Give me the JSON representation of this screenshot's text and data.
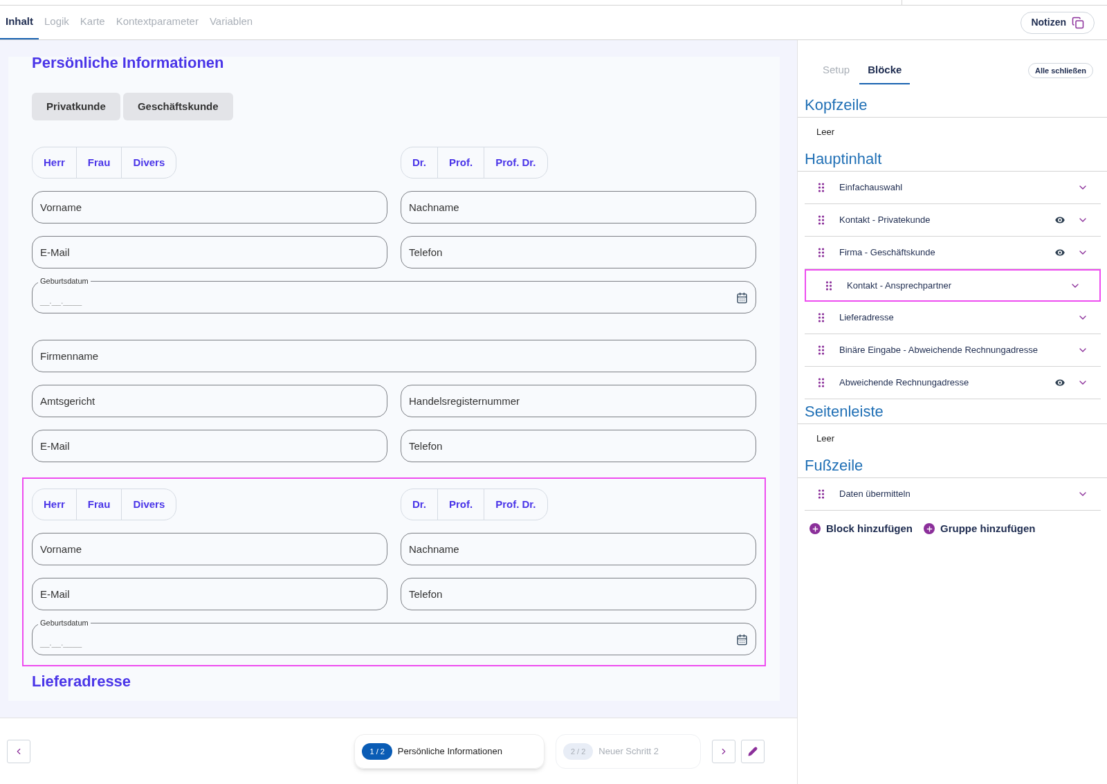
{
  "tabs": [
    {
      "label": "Inhalt",
      "selected": true
    },
    {
      "label": "Logik",
      "selected": false
    },
    {
      "label": "Karte",
      "selected": false
    },
    {
      "label": "Kontextparameter",
      "selected": false
    },
    {
      "label": "Variablen",
      "selected": false
    }
  ],
  "notes_button": "Notizen",
  "form": {
    "title": "Persönliche Informationen",
    "customer_types": [
      "Privatkunde",
      "Geschäftskunde"
    ],
    "blocks": [
      {
        "highlighted": false,
        "rows": [
          {
            "kind": "toggles",
            "left": [
              "Herr",
              "Frau",
              "Divers"
            ],
            "right": [
              "Dr.",
              "Prof.",
              "Prof. Dr."
            ]
          },
          {
            "kind": "fields",
            "fields": [
              {
                "placeholder": "Vorname"
              },
              {
                "placeholder": "Nachname"
              }
            ]
          },
          {
            "kind": "fields",
            "fields": [
              {
                "placeholder": "E-Mail"
              },
              {
                "placeholder": "Telefon"
              }
            ]
          },
          {
            "kind": "date",
            "label": "Geburtsdatum",
            "placeholder": "__.__.____"
          }
        ]
      },
      {
        "highlighted": false,
        "rows": [
          {
            "kind": "fields",
            "fields": [
              {
                "placeholder": "Firmenname"
              }
            ]
          },
          {
            "kind": "fields",
            "fields": [
              {
                "placeholder": "Amtsgericht"
              },
              {
                "placeholder": "Handelsregisternummer"
              }
            ]
          },
          {
            "kind": "fields",
            "fields": [
              {
                "placeholder": "E-Mail"
              },
              {
                "placeholder": "Telefon"
              }
            ]
          }
        ]
      },
      {
        "highlighted": true,
        "rows": [
          {
            "kind": "toggles",
            "left": [
              "Herr",
              "Frau",
              "Divers"
            ],
            "right": [
              "Dr.",
              "Prof.",
              "Prof. Dr."
            ]
          },
          {
            "kind": "fields",
            "fields": [
              {
                "placeholder": "Vorname"
              },
              {
                "placeholder": "Nachname"
              }
            ]
          },
          {
            "kind": "fields",
            "fields": [
              {
                "placeholder": "E-Mail"
              },
              {
                "placeholder": "Telefon"
              }
            ]
          },
          {
            "kind": "date",
            "label": "Geburtsdatum",
            "placeholder": "__.__.____"
          }
        ]
      }
    ],
    "next_heading": "Lieferadresse"
  },
  "steps": [
    {
      "number": "1 / 2",
      "label": "Persönliche Informationen",
      "selected": true
    },
    {
      "number": "2 / 2",
      "label": "Neuer Schritt 2",
      "selected": false
    }
  ],
  "panel": {
    "tabs": [
      {
        "label": "Setup",
        "selected": false
      },
      {
        "label": "Blöcke",
        "selected": true
      }
    ],
    "collapse_button": "Alle schließen",
    "sections": [
      {
        "title": "Kopfzeile",
        "empty_text": "Leer"
      },
      {
        "title": "Hauptinhalt",
        "items": [
          {
            "label": "Einfachauswahl",
            "conditional": false,
            "highlighted": false
          },
          {
            "label": "Kontakt - Privatekunde",
            "conditional": true,
            "highlighted": false
          },
          {
            "label": "Firma - Geschäftskunde",
            "conditional": true,
            "highlighted": false
          },
          {
            "label": "Kontakt - Ansprechpartner",
            "conditional": false,
            "highlighted": true
          },
          {
            "label": "Lieferadresse",
            "conditional": false,
            "highlighted": false
          },
          {
            "label": "Binäre Eingabe - Abweichende Rechnungadresse",
            "conditional": false,
            "highlighted": false
          },
          {
            "label": "Abweichende Rechnungadresse",
            "conditional": true,
            "highlighted": false
          }
        ]
      },
      {
        "title": "Seitenleiste",
        "empty_text": "Leer"
      },
      {
        "title": "Fußzeile",
        "items": [
          {
            "label": "Daten übermitteln",
            "conditional": false,
            "highlighted": false
          }
        ]
      }
    ],
    "add_buttons": [
      "Block hinzufügen",
      "Gruppe hinzufügen"
    ]
  }
}
